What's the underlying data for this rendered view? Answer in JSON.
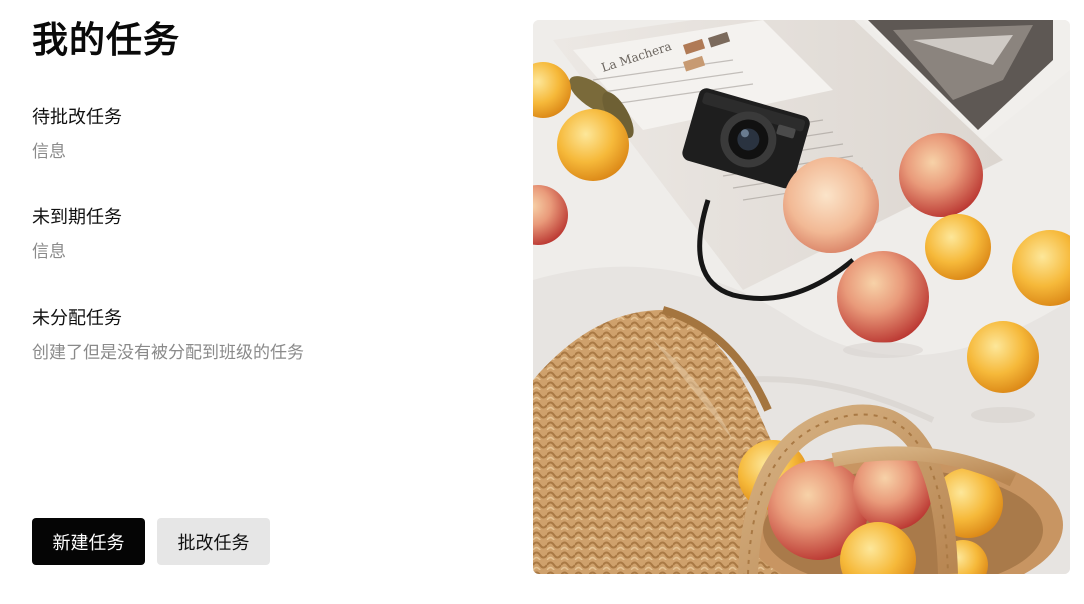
{
  "page": {
    "title": "我的任务"
  },
  "sections": [
    {
      "title": "待批改任务",
      "description": "信息"
    },
    {
      "title": "未到期任务",
      "description": "信息"
    },
    {
      "title": "未分配任务",
      "description": "创建了但是没有被分配到班级的任务"
    }
  ],
  "actions": {
    "new_task_label": "新建任务",
    "review_task_label": "批改任务"
  },
  "hero_image": {
    "subject": "picnic still life: camera, peaches, woven straw bag, magazine on white blanket",
    "magazine_text": "La Machera"
  },
  "colors": {
    "primary_button": "#050505",
    "secondary_button": "#e6e6e6",
    "muted_text": "#8a8a8a"
  }
}
